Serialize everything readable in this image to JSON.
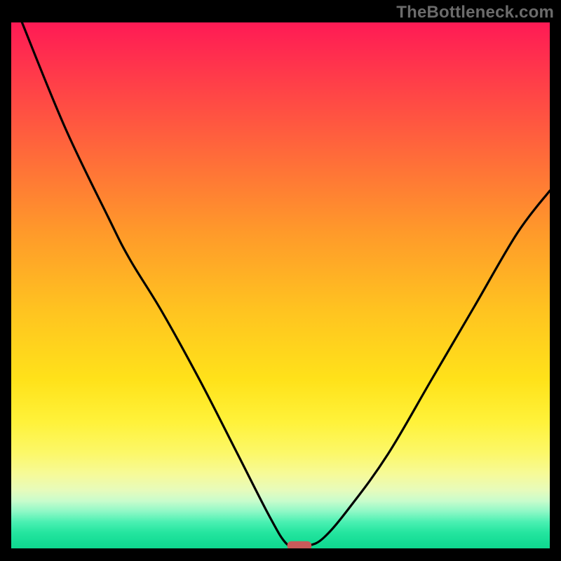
{
  "watermark": "TheBottleneck.com",
  "chart_data": {
    "type": "line",
    "title": "",
    "xlabel": "",
    "ylabel": "",
    "xlim": [
      0,
      100
    ],
    "ylim": [
      0,
      100
    ],
    "grid": false,
    "legend": false,
    "curve_points": [
      {
        "x": 2,
        "y": 100
      },
      {
        "x": 10,
        "y": 80
      },
      {
        "x": 18,
        "y": 63
      },
      {
        "x": 22,
        "y": 55
      },
      {
        "x": 28,
        "y": 45
      },
      {
        "x": 35,
        "y": 32
      },
      {
        "x": 42,
        "y": 18
      },
      {
        "x": 48,
        "y": 6
      },
      {
        "x": 51,
        "y": 1
      },
      {
        "x": 53,
        "y": 0.5
      },
      {
        "x": 55,
        "y": 0.5
      },
      {
        "x": 58,
        "y": 2
      },
      {
        "x": 63,
        "y": 8
      },
      {
        "x": 70,
        "y": 18
      },
      {
        "x": 78,
        "y": 32
      },
      {
        "x": 86,
        "y": 46
      },
      {
        "x": 94,
        "y": 60
      },
      {
        "x": 100,
        "y": 68
      }
    ],
    "marker": {
      "x_center": 53.5,
      "width_pct": 4.5,
      "y": 0.5,
      "color": "#c95a5a"
    },
    "gradient_stops": [
      {
        "pct": 0,
        "color": "#ff1a55"
      },
      {
        "pct": 100,
        "color": "#10d88f"
      }
    ]
  }
}
